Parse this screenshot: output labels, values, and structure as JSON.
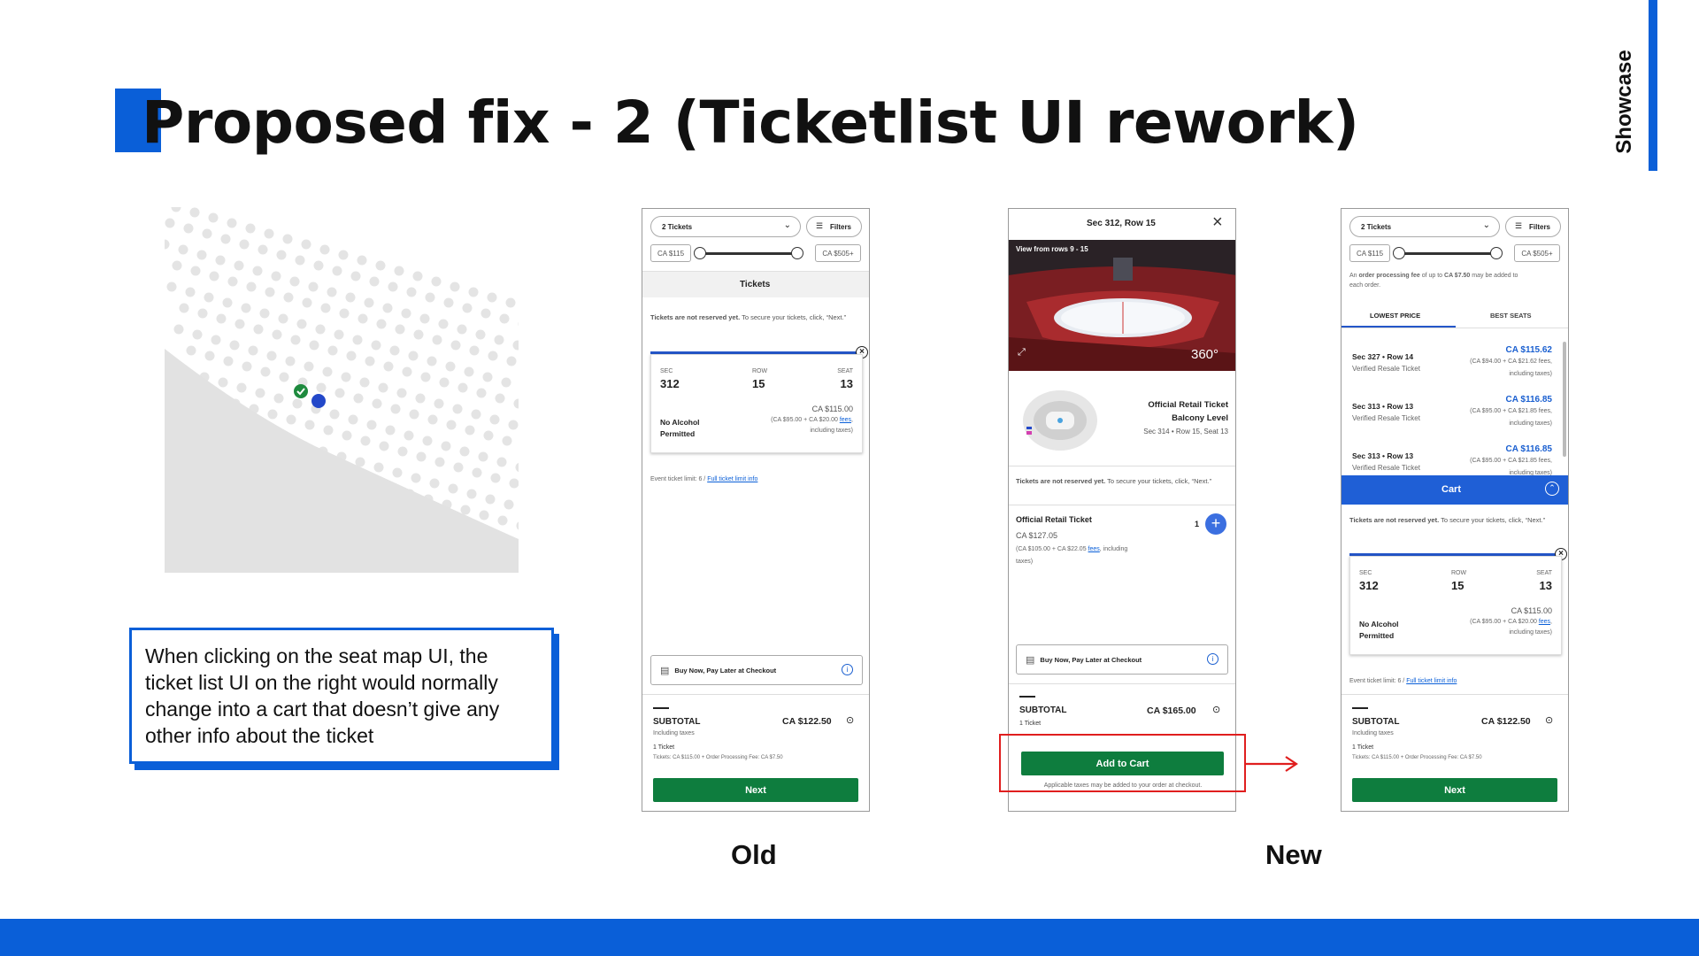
{
  "slide": {
    "title": "Proposed fix - 2 (Ticketlist UI rework)",
    "side_label": "Showcase",
    "note": "When clicking on the seat map UI, the ticket list UI on the right would normally change into a cart that doesn’t give any other info about the ticket",
    "caption_old": "Old",
    "caption_new": "New",
    "colors": {
      "accent": "#0a5fd8",
      "green": "#0e7d3e",
      "highlight": "#e01e1e"
    }
  },
  "old": {
    "qty_select": "2 Tickets",
    "filters": "Filters",
    "price_min": "CA $115",
    "price_max": "CA $505+",
    "tab": "Tickets",
    "notice_bold": "Tickets are not reserved yet.",
    "notice_rest": " To secure your tickets, click, “Next.”",
    "sec_label": "SEC",
    "sec": "312",
    "row_label": "ROW",
    "row": "15",
    "seat_label": "SEAT",
    "seat": "13",
    "restriction": "No Alcohol Permitted",
    "ticket_price": "CA $115.00",
    "ticket_breakdown_a": "(CA $95.00 + CA $20.00 ",
    "fees": "fees",
    "ticket_breakdown_b": ",",
    "ticket_breakdown_c": "including taxes)",
    "limit_text": "Event ticket limit: 6 / ",
    "limit_link": "Full ticket limit info",
    "bnpl": "Buy Now, Pay Later at Checkout",
    "subtotal_label": "SUBTOTAL",
    "subtotal": "CA $122.50",
    "including_taxes": "Including taxes",
    "qty_line": "1 Ticket",
    "breakdown_line": "Tickets: CA $115.00 + Order Processing Fee: CA $7.50",
    "next": "Next"
  },
  "mid": {
    "header": "Sec 312, Row 15",
    "view_label": "View from rows 9 - 15",
    "badge_360": "360°",
    "listing_title": "Official Retail Ticket",
    "listing_level": "Balcony Level",
    "listing_seat": "Sec 314 • Row 15, Seat 13",
    "notice_bold": "Tickets are not reserved yet.",
    "notice_rest": " To secure your tickets, click, “Next.”",
    "item_title": "Official Retail Ticket",
    "item_price": "CA $127.05",
    "item_breakdown_a": "(CA $105.00 + CA $22.05 ",
    "fees": "fees",
    "item_breakdown_b": ", including",
    "item_breakdown_c": "taxes)",
    "qty": "1",
    "bnpl": "Buy Now, Pay Later at Checkout",
    "subtotal_label": "SUBTOTAL",
    "subtotal": "CA $165.00",
    "qty_line": "1 Ticket",
    "add_to_cart": "Add to Cart",
    "taxes_note": "Applicable taxes may be added to your order at checkout."
  },
  "new": {
    "qty_select": "2 Tickets",
    "filters": "Filters",
    "price_min": "CA $115",
    "price_max": "CA $505+",
    "fee_note_a": "An ",
    "fee_note_b": "order processing fee",
    "fee_note_c": " of up to ",
    "fee_note_d": "CA $7.50",
    "fee_note_e": " may be added to",
    "fee_note_f": "each order.",
    "tab_lowest": "LOWEST PRICE",
    "tab_best": "BEST SEATS",
    "listings": [
      {
        "title": "Sec 327 • Row 14",
        "sub": "Verified Resale Ticket",
        "price": "CA $115.62",
        "detail1": "(CA $94.00 + CA $21.62 fees,",
        "detail2": "including taxes)"
      },
      {
        "title": "Sec 313 • Row 13",
        "sub": "Verified Resale Ticket",
        "price": "CA $116.85",
        "detail1": "(CA $95.00 + CA $21.85 fees,",
        "detail2": "including taxes)"
      },
      {
        "title": "Sec 313 • Row 13",
        "sub": "Verified Resale Ticket",
        "price": "CA $116.85",
        "detail1": "(CA $95.00 + CA $21.85 fees,",
        "detail2": "including taxes)"
      }
    ],
    "cart": "Cart",
    "notice_bold": "Tickets are not reserved yet.",
    "notice_rest": " To secure your tickets, click, “Next.”",
    "sec_label": "SEC",
    "sec": "312",
    "row_label": "ROW",
    "row": "15",
    "seat_label": "SEAT",
    "seat": "13",
    "restriction": "No Alcohol Permitted",
    "ticket_price": "CA $115.00",
    "ticket_breakdown_a": "(CA $95.00 + CA $20.00 ",
    "fees": "fees",
    "ticket_breakdown_b": ",",
    "ticket_breakdown_c": "including taxes)",
    "limit_text": "Event ticket limit: 6 / ",
    "limit_link": "Full ticket limit info",
    "subtotal_label": "SUBTOTAL",
    "subtotal": "CA $122.50",
    "including_taxes": "Including taxes",
    "qty_line": "1 Ticket",
    "breakdown_line": "Tickets: CA $115.00 + Order Processing Fee: CA $7.50",
    "next": "Next"
  }
}
